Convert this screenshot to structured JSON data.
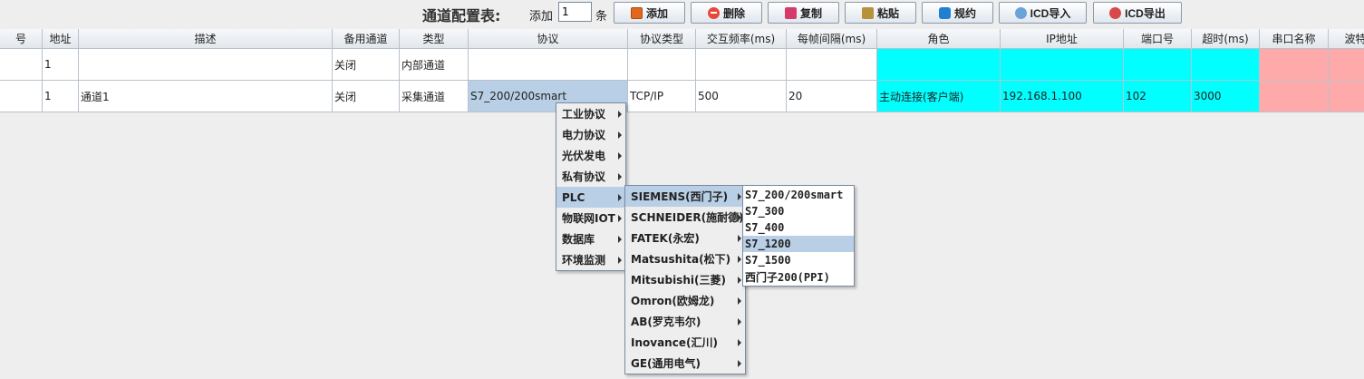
{
  "toolbar": {
    "title": "通道配置表:",
    "add_label": "添加",
    "add_count": "1",
    "unit": "条",
    "buttons": [
      {
        "label": "添加",
        "icon": "add-icon"
      },
      {
        "label": "删除",
        "icon": "delete-icon"
      },
      {
        "label": "复制",
        "icon": "copy-icon"
      },
      {
        "label": "粘贴",
        "icon": "paste-icon"
      },
      {
        "label": "规约",
        "icon": "settings-icon"
      },
      {
        "label": "ICD导入",
        "icon": "import-icon"
      },
      {
        "label": "ICD导出",
        "icon": "export-icon"
      }
    ]
  },
  "table": {
    "headers": [
      "号",
      "地址",
      "描述",
      "备用通道",
      "类型",
      "协议",
      "协议类型",
      "交互频率(ms)",
      "每帧间隔(ms)",
      "角色",
      "IP地址",
      "端口号",
      "超时(ms)",
      "串口名称",
      "波特"
    ],
    "rows": [
      [
        "",
        "1",
        "",
        "关闭",
        "内部通道",
        "",
        "",
        "",
        "",
        "",
        "",
        "",
        "",
        "",
        ""
      ],
      [
        "",
        "1",
        "通道1",
        "关闭",
        "采集通道",
        "S7_200/200smart",
        "TCP/IP",
        "500",
        "20",
        "主动连接(客户端)",
        "192.168.1.100",
        "102",
        "3000",
        "",
        ""
      ]
    ]
  },
  "menu_protocol": {
    "items": [
      "工业协议",
      "电力协议",
      "光伏发电",
      "私有协议",
      "PLC",
      "物联网IOT",
      "数据库",
      "环境监测"
    ],
    "highlighted": "PLC"
  },
  "menu_plc": {
    "items": [
      "SIEMENS(西门子)",
      "SCHNEIDER(施耐德)",
      "FATEK(永宏)",
      "Matsushita(松下)",
      "Mitsubishi(三菱)",
      "Omron(欧姆龙)",
      "AB(罗克韦尔)",
      "Inovance(汇川)",
      "GE(通用电气)"
    ],
    "highlighted": "SIEMENS(西门子)"
  },
  "menu_siemens": {
    "items": [
      "S7_200/200smart",
      "S7_300",
      "S7_400",
      "S7_1200",
      "S7_1500",
      "西门子200(PPI)"
    ],
    "highlighted": "S7_1200"
  }
}
